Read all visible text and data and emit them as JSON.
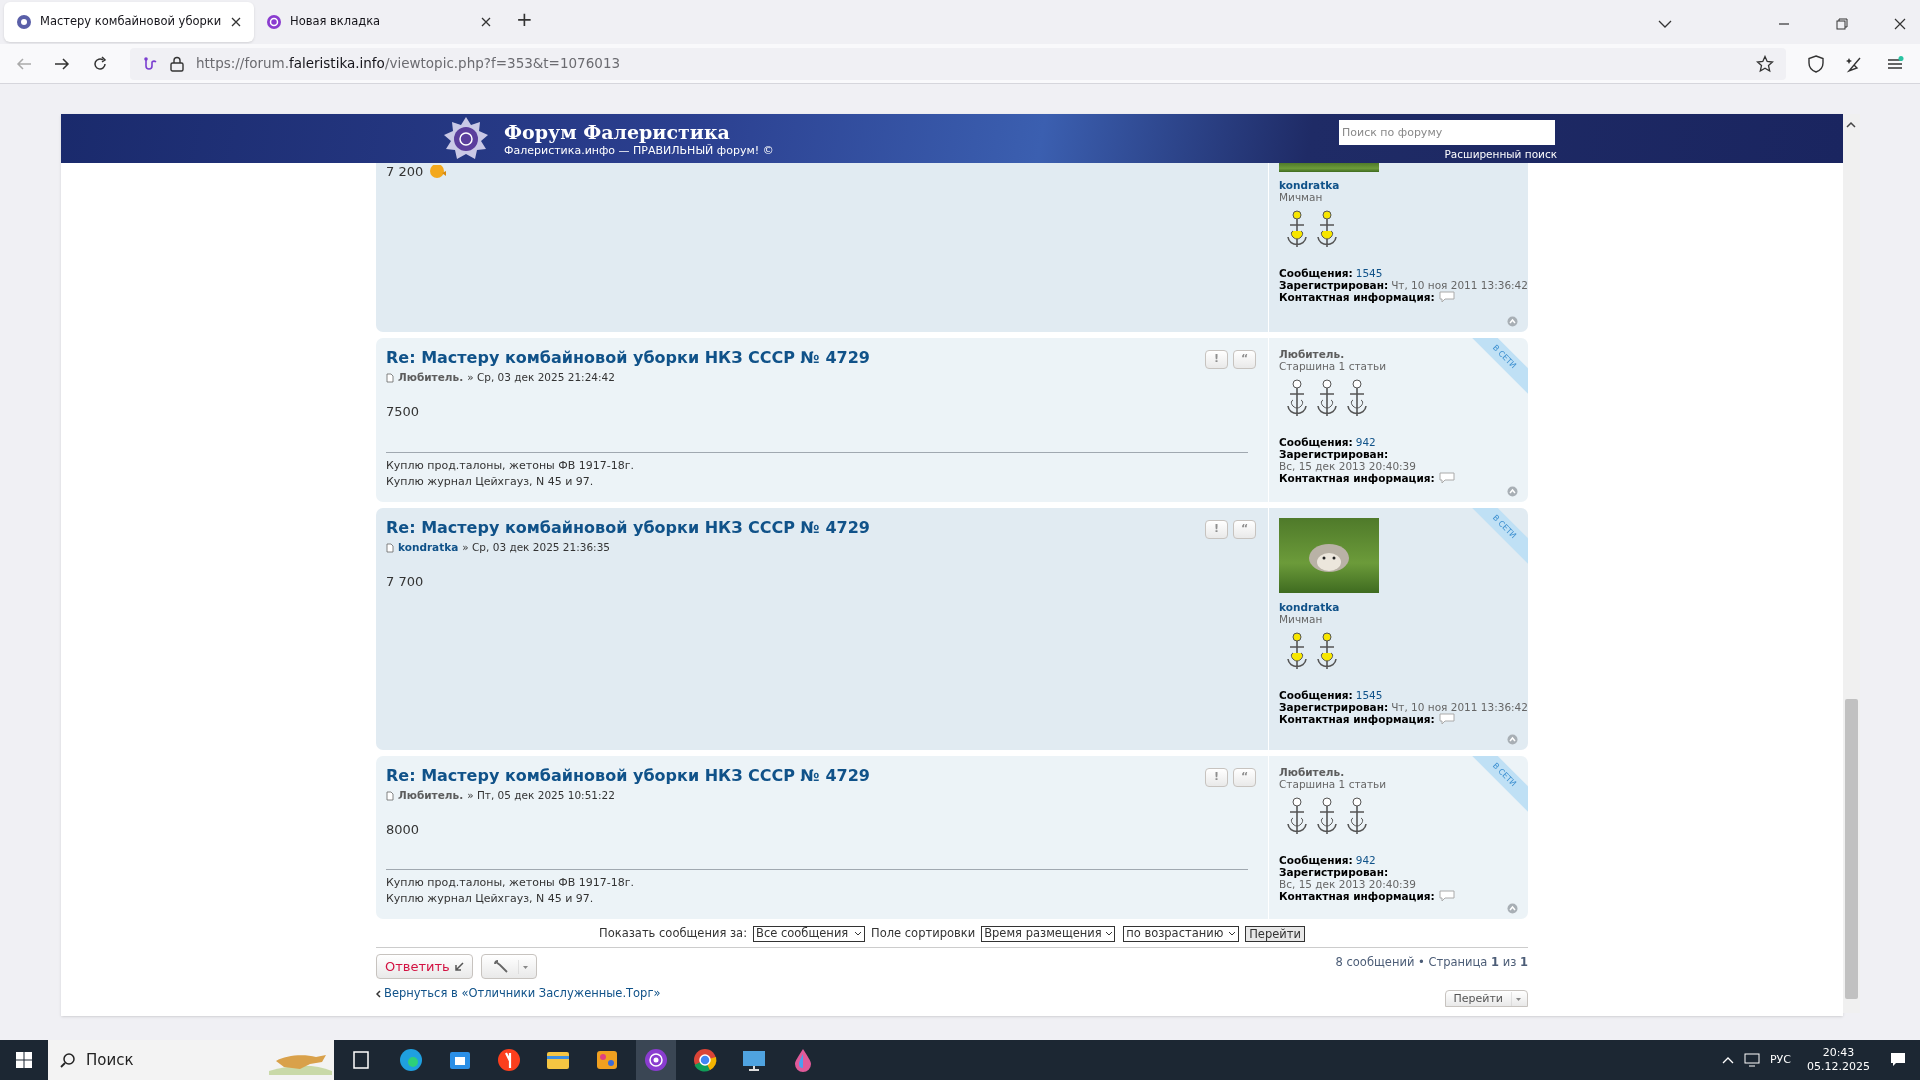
{
  "browser": {
    "tabs": [
      {
        "title": "Мастеру комбайновой уборки",
        "selected": true
      },
      {
        "title": "Новая вкладка",
        "selected": false
      }
    ],
    "new_tab": "+",
    "url": "https://forum.**faleristika.info**/viewtopic.php?f=353&t=1076013"
  },
  "header": {
    "title": "Форум Фалеристика",
    "subtitle": "Фалеристика.инфо — ПРАВИЛЬНЫЙ форум! ©",
    "search": {
      "placeholder": "Поиск по форуму"
    },
    "advanced_search": "Расширенный поиск"
  },
  "posts": [
    {
      "kind": "partial",
      "body": "7 200",
      "profile": {
        "avatar": true,
        "username": "kondratka",
        "color": "#105289",
        "rank": "Мичман",
        "kind": "gold",
        "posts_label": "Сообщения:",
        "posts": "1545",
        "registered_label": "Зарегистрирован:",
        "registered": "Чт, 10 ноя 2011 13:36:42",
        "contact": "Контактная информация:"
      }
    },
    {
      "kind": "full",
      "title": "Re: Мастеру комбайновой уборки НКЗ СССР № 4729",
      "buttons": [
        "!",
        "“"
      ],
      "author": "Любитель.",
      "date": "» Ср, 03 дек 2025 21:24:42",
      "body": "7500",
      "signature": [
        "Куплю прод.талоны, жетоны ФВ 1917-18г.",
        "Куплю журнал Цейхгауз, N 45 и 97."
      ],
      "online_badge": "В СЕТИ",
      "profile": {
        "avatar": false,
        "username": "Любитель.",
        "color": "#5d5d5d",
        "rank": "Старшина 1 статьи",
        "kind": "outline",
        "posts_label": "Сообщения:",
        "posts": "942",
        "registered_label": "Зарегистрирован:",
        "registered": "Вс, 15 дек 2013 20:40:39",
        "contact": "Контактная информация:"
      }
    },
    {
      "kind": "full",
      "title": "Re: Мастеру комбайновой уборки НКЗ СССР № 4729",
      "buttons": [
        "!",
        "“"
      ],
      "author": "kondratka",
      "date": "» Ср, 03 дек 2025 21:36:35",
      "body": "7 700",
      "online_badge": "В СЕТИ",
      "profile": {
        "avatar": true,
        "username": "kondratka",
        "color": "#105289",
        "rank": "Мичман",
        "kind": "gold",
        "posts_label": "Сообщения:",
        "posts": "1545",
        "registered_label": "Зарегистрирован:",
        "registered": "Чт, 10 ноя 2011 13:36:42",
        "contact": "Контактная информация:"
      }
    },
    {
      "kind": "full",
      "title": "Re: Мастеру комбайновой уборки НКЗ СССР № 4729",
      "buttons": [
        "!",
        "“"
      ],
      "author": "Любитель.",
      "date": "» Пт, 05 дек 2025 10:51:22",
      "body": "8000",
      "signature": [
        "Куплю прод.талоны, жетоны ФВ 1917-18г.",
        "Куплю журнал Цейхгауз, N 45 и 97."
      ],
      "online_badge": "В СЕТИ",
      "profile": {
        "avatar": false,
        "username": "Любитель.",
        "color": "#5d5d5d",
        "rank": "Старшина 1 статьи",
        "kind": "outline",
        "posts_label": "Сообщения:",
        "posts": "942",
        "registered_label": "Зарегистрирован:",
        "registered": "Вс, 15 дек 2013 20:40:39",
        "contact": "Контактная информация:"
      }
    }
  ],
  "sort_bar": {
    "show_label": "Показать сообщения за:",
    "show_value": "Все сообщения",
    "sort_label": "Поле сортировки",
    "sort_value": "Время размещения",
    "order_value": "по возрастанию",
    "go": "Перейти"
  },
  "actions": {
    "reply": "Ответить",
    "pagination": "8 сообщений • Страница **1** из **1**",
    "back": "Вернуться в «Отличники Заслуженные.Торг»",
    "jump": "Перейти"
  },
  "taskbar": {
    "search": "Поиск",
    "language": "РУС",
    "time": "20:43",
    "date": "05.12.2025"
  }
}
